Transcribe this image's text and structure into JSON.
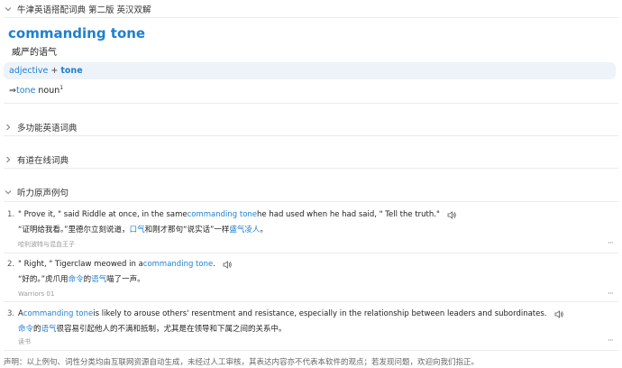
{
  "sections": {
    "oxford": "牛津英语搭配词典 第二版 英汉双解",
    "multi": "多功能英语词典",
    "youdao": "有道在线词典",
    "listening": "听力原声例句"
  },
  "entry": {
    "headword": "commanding tone",
    "translation": "威严的语气",
    "colloc_kw": "adjective",
    "colloc_plus": "+",
    "colloc_tone": "tone",
    "xref_arrow": "⇒",
    "xref_link": "tone",
    "xref_pos": "noun",
    "xref_sup": "1"
  },
  "examples": [
    {
      "num": "1.",
      "en_pre": "\" Prove it, \" said Riddle at once, in the same ",
      "en_hl": "commanding tone",
      "en_post": " he had used when he had said, \" Tell the truth.\"",
      "zh_pre": "“证明给我看。”里德尔立刻说道，",
      "zh_hl1": "口气",
      "zh_mid": "和刚才那句“说实话”一样",
      "zh_hl2": "盛气凌人",
      "zh_post": "。",
      "src": "哈利波特与混血王子"
    },
    {
      "num": "2.",
      "en_pre": "\" Right, \" Tigerclaw meowed in a ",
      "en_hl": "commanding tone",
      "en_post": ".",
      "zh_pre": "“好的。”虎爪用",
      "zh_hl1": "命令",
      "zh_mid": "的",
      "zh_hl2": "语气",
      "zh_post": "喵了一声。",
      "src": "Warriors 01"
    },
    {
      "num": "3.",
      "en_pre": "A ",
      "en_hl": "commanding tone",
      "en_post": " is likely to arouse others' resentment and resistance, especially in the relationship between leaders and subordinates.",
      "zh_pre": "",
      "zh_hl1": "命令",
      "zh_mid": "的",
      "zh_hl2": "语气",
      "zh_post": "很容易引起他人的不满和抵制，尤其是在领导和下属之间的关系中。",
      "src": "读书"
    }
  ],
  "more_glyph": "···",
  "footer": "声明：以上例句、词性分类均由互联网资源自动生成，未经过人工审核，其表达内容亦不代表本软件的观点；若发现问题，欢迎向我们指正。",
  "colors": {
    "accent": "#1e7fd0",
    "bar_bg": "#eef3fa"
  }
}
